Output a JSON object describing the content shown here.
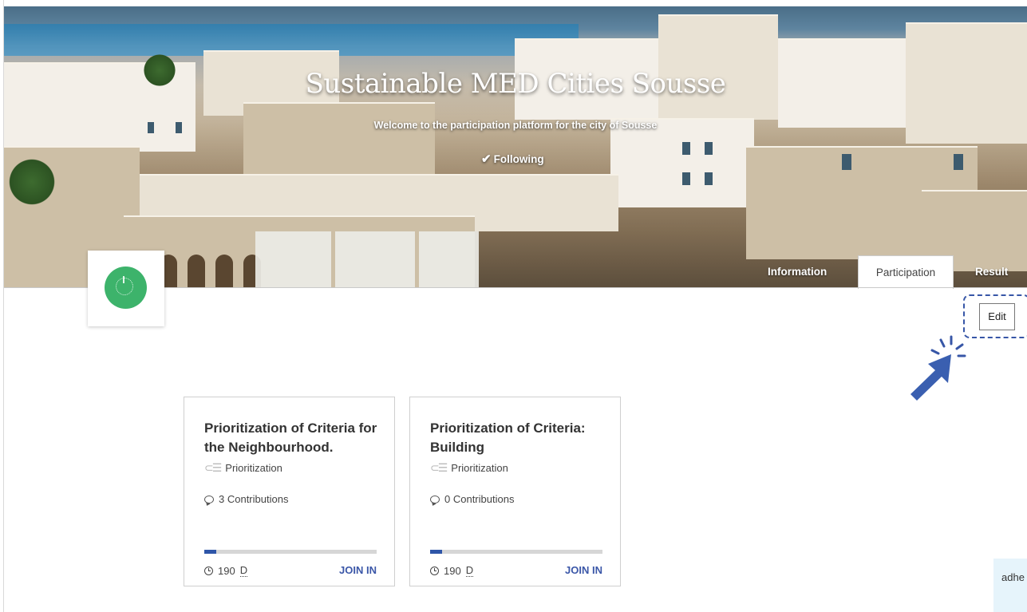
{
  "hero": {
    "title": "Sustainable MED Cities Sousse",
    "subtitle": "Welcome to the participation platform for the city of Sousse",
    "follow_label": "Following"
  },
  "tabs": [
    {
      "label": "Information",
      "active": false
    },
    {
      "label": "Participation",
      "active": true
    },
    {
      "label": "Result",
      "active": false
    }
  ],
  "edit_label": "Edit",
  "cards": [
    {
      "title": "Prioritization of Criteria for the Neighbourhood.",
      "type": "Prioritization",
      "contributions": "3 Contributions",
      "time_value": "190",
      "time_unit": "D",
      "progress": 0.07,
      "action": "JOIN IN"
    },
    {
      "title": "Prioritization of Criteria: Building",
      "type": "Prioritization",
      "contributions": "0 Contributions",
      "time_value": "190",
      "time_unit": "D",
      "progress": 0.07,
      "action": "JOIN IN"
    }
  ],
  "hint_text": "adhe",
  "colors": {
    "accent": "#3b57a8",
    "logo_green": "#3db36b",
    "progress_fill": "#2e55a8",
    "progress_track": "#d6d6d6"
  }
}
